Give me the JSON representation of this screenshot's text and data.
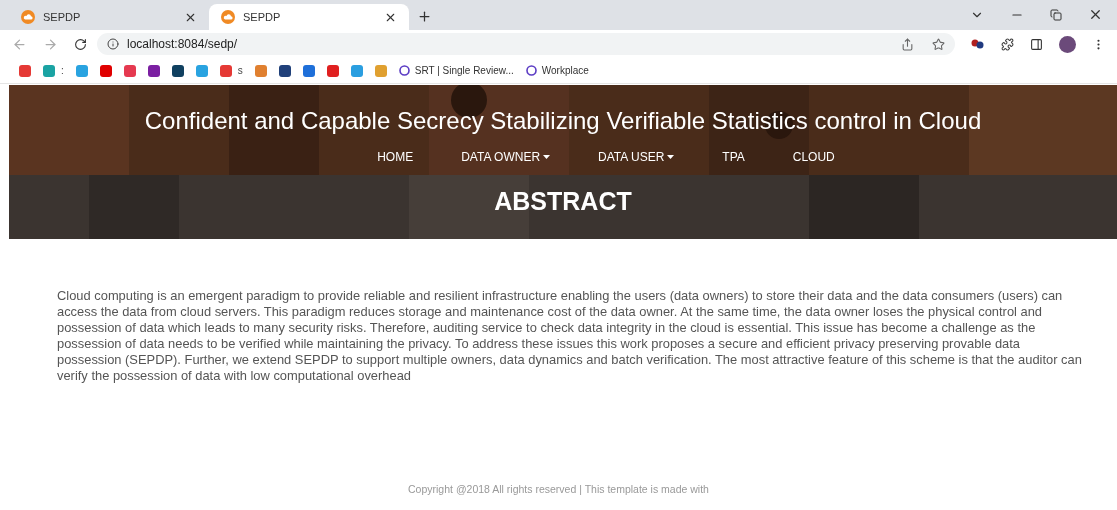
{
  "browser": {
    "tabs": [
      {
        "title": "SEPDP",
        "selected": false
      },
      {
        "title": "SEPDP",
        "selected": true
      }
    ],
    "address": "localhost:8084/sedp/",
    "bookmarks": [
      {
        "kind": "icon"
      },
      {
        "kind": "icon"
      },
      {
        "kind": "text",
        "label": ":"
      },
      {
        "kind": "icon"
      },
      {
        "kind": "icon"
      },
      {
        "kind": "icon"
      },
      {
        "kind": "icon"
      },
      {
        "kind": "icon"
      },
      {
        "kind": "icon"
      },
      {
        "kind": "icon"
      },
      {
        "kind": "text",
        "label": "s"
      },
      {
        "kind": "icon"
      },
      {
        "kind": "icon"
      },
      {
        "kind": "icon"
      },
      {
        "kind": "icon"
      },
      {
        "kind": "icon"
      },
      {
        "kind": "icon"
      },
      {
        "kind": "link",
        "label": "SRT | Single Review..."
      },
      {
        "kind": "link",
        "label": "Workplace"
      }
    ]
  },
  "header": {
    "title": "Confident and Capable Secrecy Stabilizing Verifiable Statistics control in Cloud",
    "nav": [
      {
        "label": "HOME",
        "dropdown": false
      },
      {
        "label": "DATA OWNER",
        "dropdown": true
      },
      {
        "label": "DATA USER",
        "dropdown": true
      },
      {
        "label": "TPA",
        "dropdown": false
      },
      {
        "label": "CLOUD",
        "dropdown": false
      }
    ]
  },
  "banner": {
    "heading": "ABSTRACT"
  },
  "abstract": "Cloud computing is an emergent paradigm to provide reliable and resilient infrastructure enabling the users (data owners) to store their data and the data consumers (users) can access the data from cloud servers. This paradigm reduces storage and maintenance cost of the data owner. At the same time, the data owner loses the physical control and possession of data which leads to many security risks. Therefore, auditing service to check data integrity in the cloud is essential. This issue has become a challenge as the possession of data needs to be verified while maintaining the privacy. To address these issues this work proposes a secure and efficient privacy preserving provable data possession (SEPDP). Further, we extend SEPDP to support multiple owners, data dynamics and batch verification. The most attractive feature of this scheme is that the auditor can verify the possession of data with low computational overhead",
  "footer": "Copyright @2018 All rights reserved | This template is made with"
}
